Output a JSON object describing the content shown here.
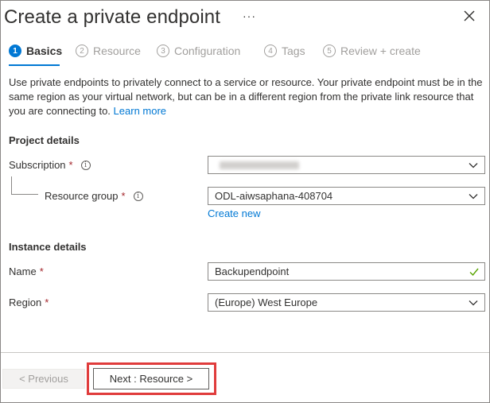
{
  "header": {
    "title": "Create a private endpoint",
    "more_label": "···"
  },
  "steps": [
    {
      "num": "1",
      "label": "Basics"
    },
    {
      "num": "2",
      "label": "Resource"
    },
    {
      "num": "3",
      "label": "Configuration"
    },
    {
      "num": "4",
      "label": "Tags"
    },
    {
      "num": "5",
      "label": "Review + create"
    }
  ],
  "intro": {
    "text": "Use private endpoints to privately connect to a service or resource. Your private endpoint must be in the same region as your virtual network, but can be in a different region from the private link resource that you are connecting to.",
    "link": "Learn more"
  },
  "project": {
    "heading": "Project details",
    "subscription_label": "Subscription",
    "resource_group_label": "Resource group",
    "resource_group_value": "ODL-aiwsaphana-408704",
    "create_new": "Create new"
  },
  "instance": {
    "heading": "Instance details",
    "name_label": "Name",
    "name_value": "Backupendpoint",
    "region_label": "Region",
    "region_value": "(Europe) West Europe"
  },
  "required_mark": "*",
  "info_glyph": "i",
  "footer": {
    "previous": "< Previous",
    "next": "Next : Resource >"
  },
  "colors": {
    "accent": "#0078d4",
    "required": "#a4262c",
    "valid": "#57a300",
    "highlight": "#e03c3c"
  }
}
